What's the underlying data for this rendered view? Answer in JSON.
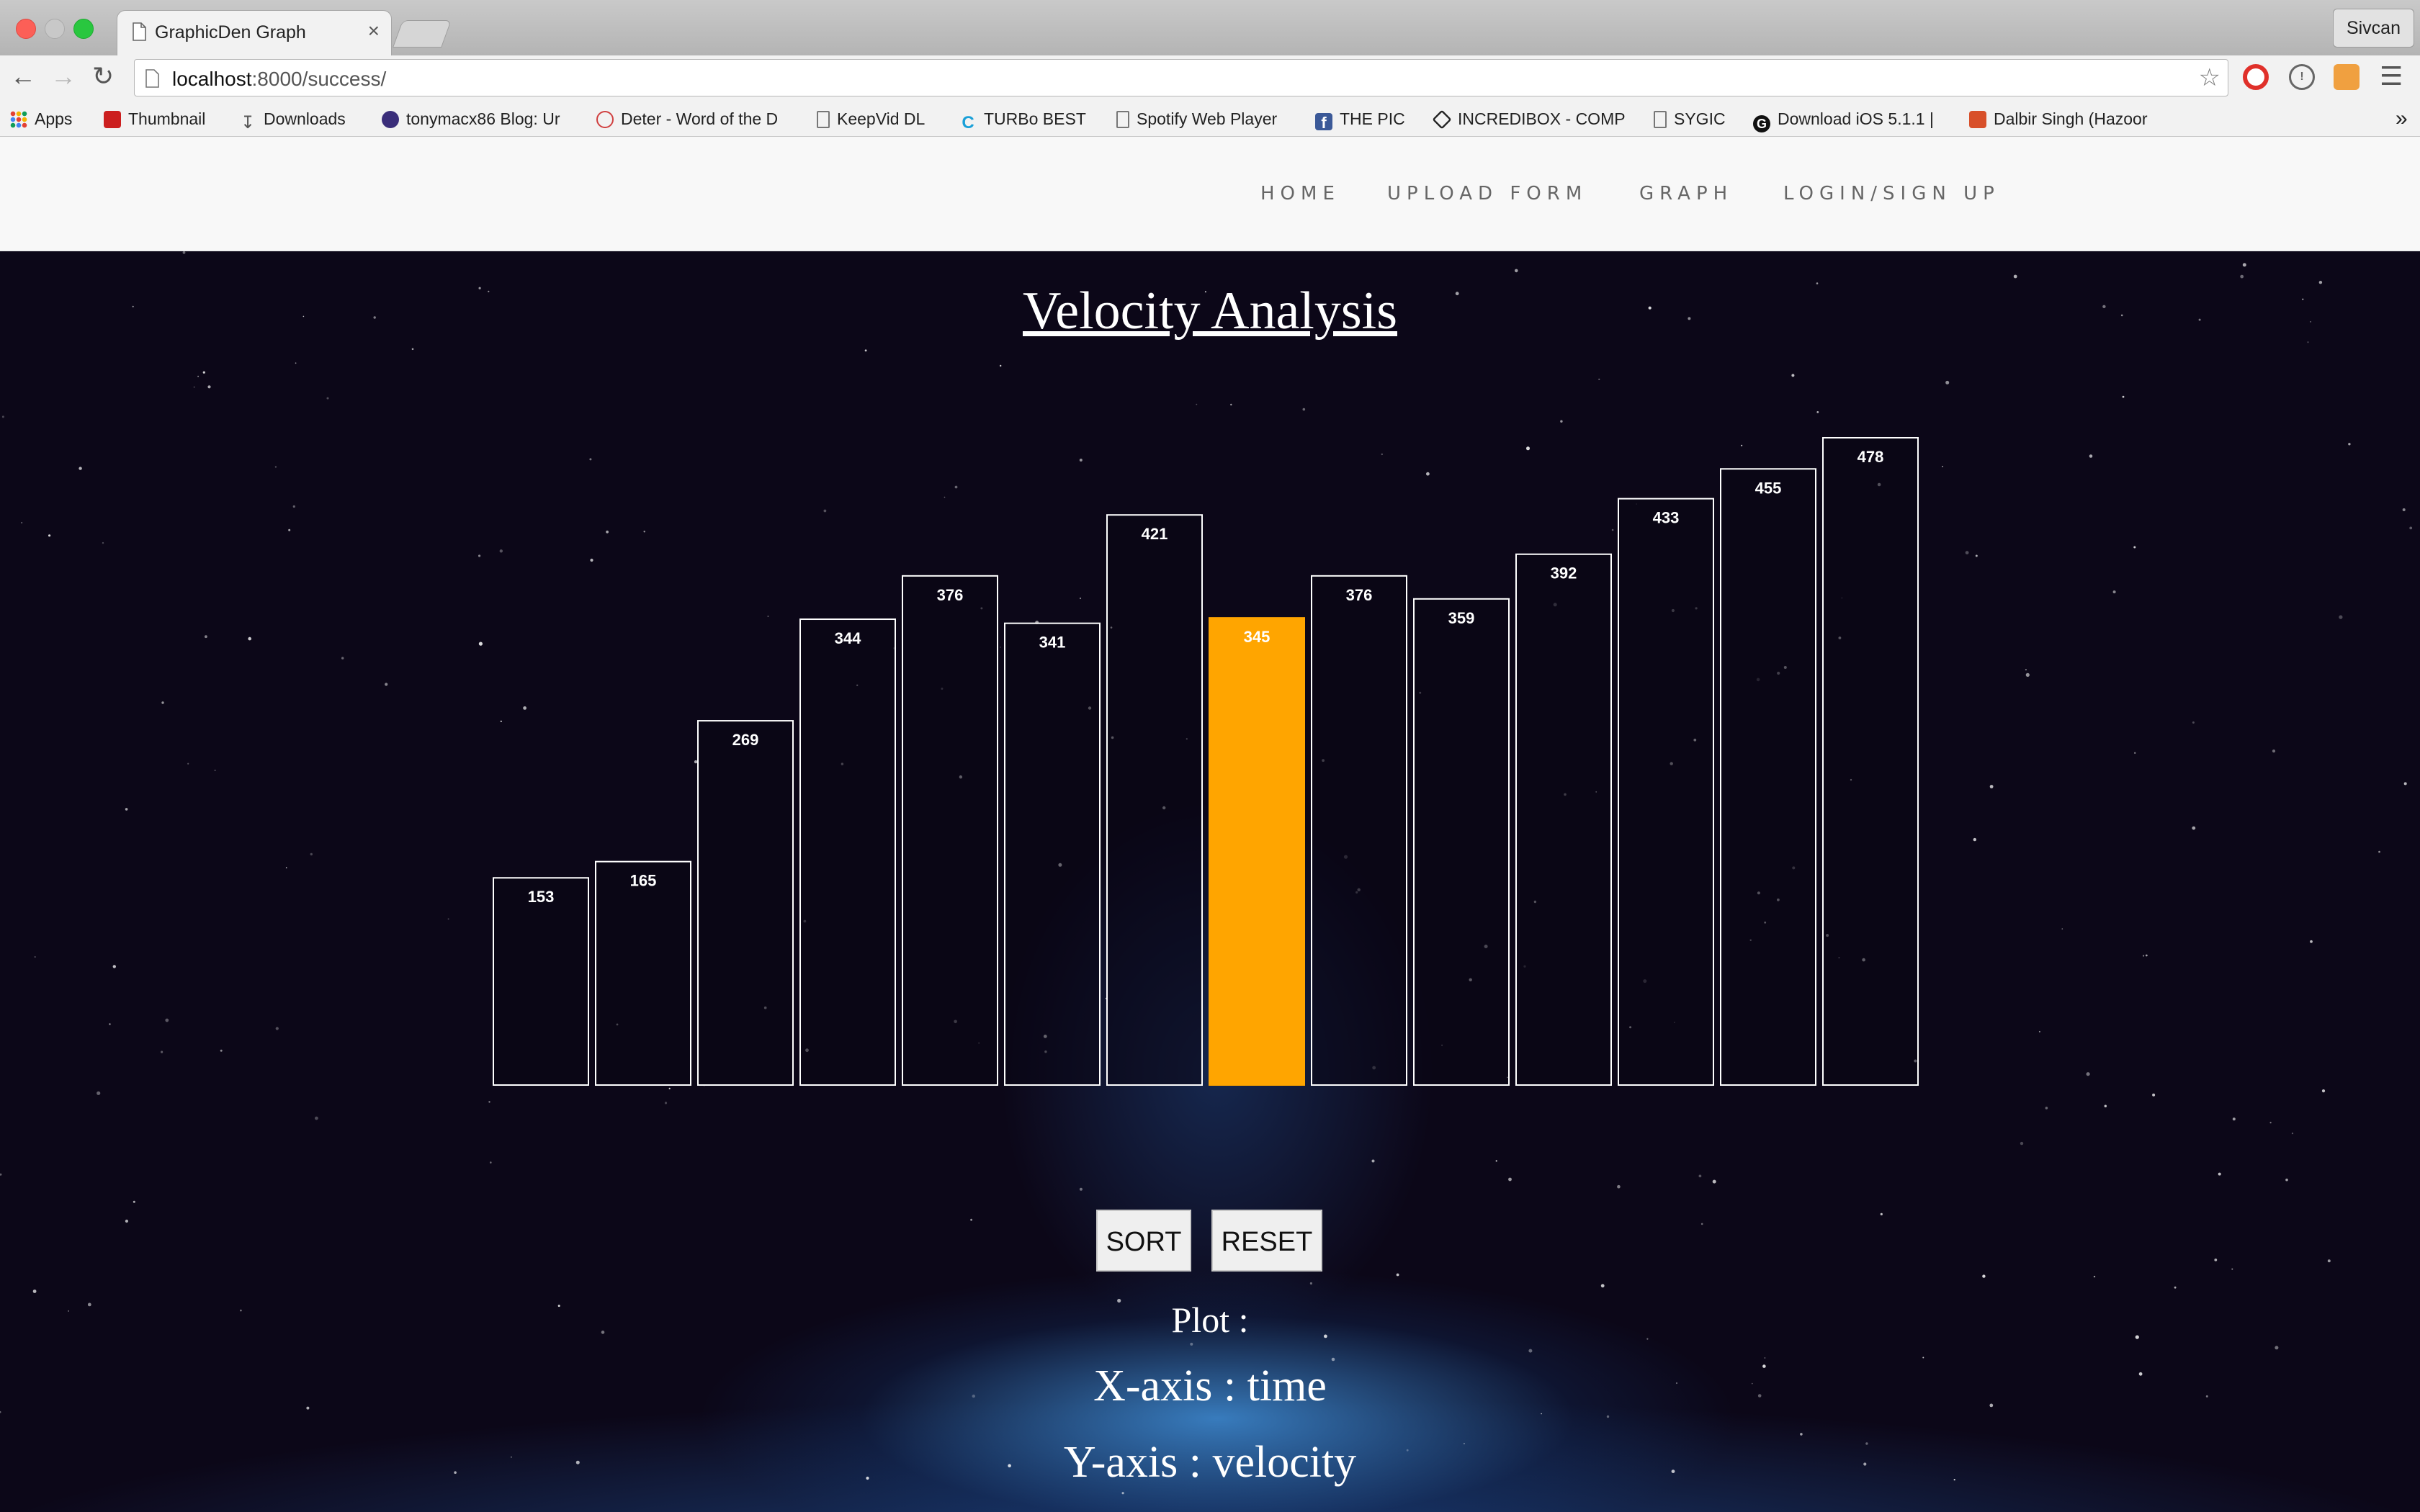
{
  "browser": {
    "tab_title": "GraphicDen Graph",
    "tab_close": "×",
    "profile_name": "Sivcan",
    "url_host": "localhost",
    "url_rest": ":8000/success/",
    "bookmarks": [
      {
        "label": "Apps",
        "icon": "apps-grid-icon",
        "color": "#e04a3a"
      },
      {
        "label": "Thumbnail",
        "icon": "youtube-icon",
        "color": "#cc1f1f"
      },
      {
        "label": "Downloads",
        "icon": "download-icon",
        "color": "#555555"
      },
      {
        "label": "tonymacx86 Blog: Ur",
        "icon": "tonymac-icon",
        "color": "#3a2e7a"
      },
      {
        "label": "Deter - Word of the D",
        "icon": "new-badge-icon",
        "color": "#d04040"
      },
      {
        "label": "KeepVid DL",
        "icon": "page-icon",
        "color": "#777777"
      },
      {
        "label": "TURBo BEST",
        "icon": "c-logo-icon",
        "color": "#1aa0d8"
      },
      {
        "label": "Spotify Web Player",
        "icon": "page-icon",
        "color": "#777777"
      },
      {
        "label": "THE PIC",
        "icon": "facebook-icon",
        "color": "#3b5998"
      },
      {
        "label": "INCREDIBOX - COMP",
        "icon": "incredibox-icon",
        "color": "#222222"
      },
      {
        "label": "SYGIC",
        "icon": "page-icon",
        "color": "#777777"
      },
      {
        "label": "Download iOS 5.1.1 |",
        "icon": "g-logo-icon",
        "color": "#111111"
      },
      {
        "label": "Dalbir Singh (Hazoor",
        "icon": "khanda-icon",
        "color": "#d8502a"
      }
    ],
    "more_bookmarks": "»"
  },
  "navbar": {
    "items": [
      "HOME",
      "UPLOAD FORM",
      "GRAPH",
      "LOGIN/SIGN UP"
    ]
  },
  "page": {
    "heading": "Velocity Analysis",
    "sort_label": "SORT",
    "reset_label": "RESET",
    "plot_label": "Plot :",
    "x_axis_label": "X-axis : time",
    "y_axis_label": "Y-axis : velocity"
  },
  "colors": {
    "highlight": "#ffa500",
    "bar_outline": "#ffffff",
    "background": "#0c0718"
  },
  "chart_data": {
    "type": "bar",
    "title": "Velocity Analysis",
    "xlabel": "",
    "ylabel": "",
    "values": [
      153,
      165,
      269,
      344,
      376,
      341,
      421,
      345,
      376,
      359,
      392,
      433,
      455,
      478
    ],
    "highlighted_index": 7,
    "grid": false
  }
}
